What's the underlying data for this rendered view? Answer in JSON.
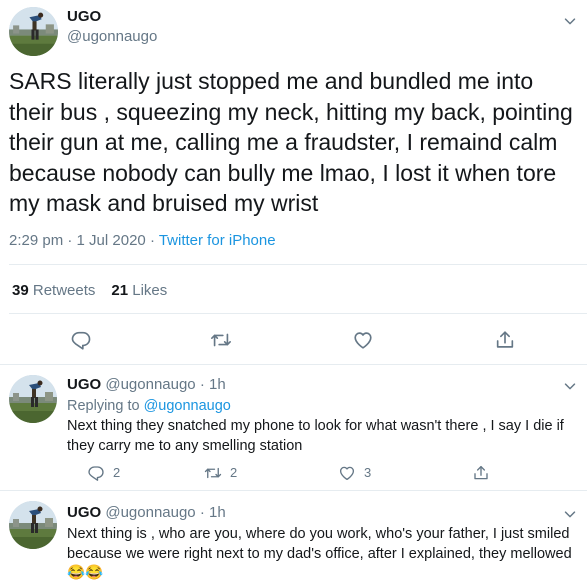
{
  "main_tweet": {
    "display_name": "UGO",
    "handle": "@ugonnaugo",
    "text": "SARS literally just stopped me and bundled me into their bus , squeezing my neck, hitting my back, pointing their gun at me, calling me a fraudster, I remaind calm because nobody can bully me lmao, I lost it when tore my mask and bruised my wrist",
    "time": "2:29 pm",
    "date": "1 Jul 2020",
    "separator": " · ",
    "source": "Twitter for iPhone",
    "retweets_count": "39",
    "retweets_label": "Retweets",
    "likes_count": "21",
    "likes_label": "Likes",
    "icons": [
      "reply-icon",
      "retweet-icon",
      "like-icon",
      "share-icon"
    ]
  },
  "replies": [
    {
      "display_name": "UGO",
      "handle": "@ugonnaugo",
      "time": "1h",
      "separator": " · ",
      "replying_label": "Replying to",
      "replying_to": "@ugonnaugo",
      "text": "Next thing they snatched my phone to look for what wasn't there , I say I die if they carry me to any smelling station",
      "reply_count": "2",
      "retweet_count": "2",
      "like_count": "3"
    },
    {
      "display_name": "UGO",
      "handle": "@ugonnaugo",
      "time": "1h",
      "separator": " · ",
      "text": "Next thing is , who are you, where do you work, who's your father, I just smiled because we were right next to my dad's office, after I explained, they mellowed 😂😂"
    }
  ],
  "colors": {
    "text": "#14171a",
    "secondary": "#657786",
    "link": "#1b95e0",
    "divider": "#e6ecf0"
  }
}
